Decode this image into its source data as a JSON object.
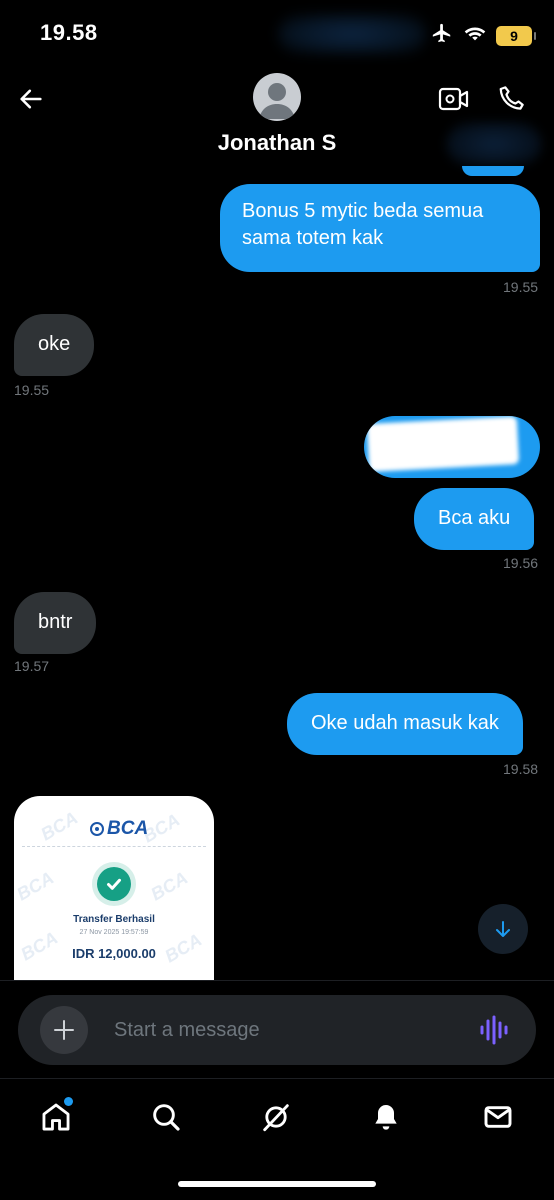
{
  "status_bar": {
    "time": "19.58",
    "battery_level": "9",
    "icons": [
      "airplane-icon",
      "wifi-icon",
      "battery-icon"
    ]
  },
  "header": {
    "contact_name": "Jonathan S",
    "icons": [
      "back-arrow-icon",
      "video-call-icon",
      "phone-call-icon"
    ]
  },
  "messages": [
    {
      "direction": "outgoing",
      "text": "Bonus 5 mytic beda semua\nsama totem kak",
      "time": "19.55"
    },
    {
      "direction": "incoming",
      "text": "oke",
      "time": "19.55"
    },
    {
      "direction": "outgoing",
      "text": "",
      "redacted": true
    },
    {
      "direction": "outgoing",
      "text": "Bca aku",
      "time": "19.56"
    },
    {
      "direction": "incoming",
      "text": "bntr",
      "time": "19.57"
    },
    {
      "direction": "outgoing",
      "text": "Oke udah masuk kak",
      "time": "19.58"
    }
  ],
  "receipt": {
    "bank_logo": "BCA",
    "watermark": "BCA",
    "status_title": "Transfer Berhasil",
    "date": "27 Nov 2025 19:57:59",
    "amount": "IDR 12,000.00"
  },
  "composer": {
    "placeholder": "Start a message"
  },
  "tabbar": {
    "items": [
      "home-icon",
      "search-icon",
      "grok-icon",
      "notifications-icon",
      "messages-icon"
    ],
    "home_has_badge": true
  },
  "colors": {
    "accent": "#1d9bf0",
    "incoming_bubble": "#2f3336",
    "background": "#000000",
    "voice_icon": "#7b61ff",
    "success": "#16a085"
  }
}
